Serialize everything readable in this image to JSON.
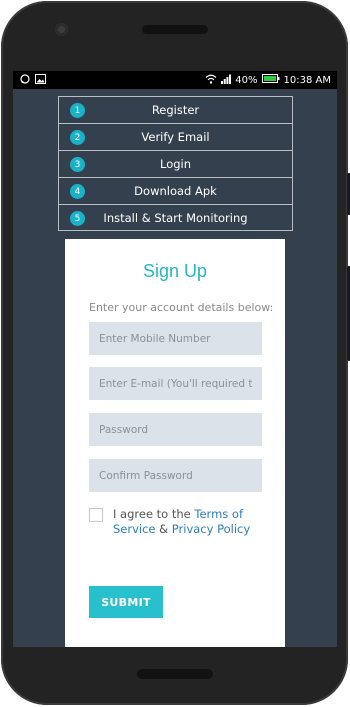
{
  "status_bar": {
    "left_icons": [
      "whatsapp-icon",
      "image-icon"
    ],
    "battery": "40%",
    "time": "10:38 AM"
  },
  "steps": [
    {
      "num": "1",
      "label": "Register"
    },
    {
      "num": "2",
      "label": "Verify Email"
    },
    {
      "num": "3",
      "label": "Login"
    },
    {
      "num": "4",
      "label": "Download Apk"
    },
    {
      "num": "5",
      "label": "Install & Start Monitoring"
    }
  ],
  "form": {
    "title": "Sign Up",
    "subtitle": "Enter your account details below:",
    "mobile_placeholder": "Enter Mobile Number",
    "email_placeholder": "Enter E-mail (You'll required to",
    "password_placeholder": "Password",
    "confirm_placeholder": "Confirm Password",
    "agree_prefix": "I agree to the ",
    "terms_link": "Terms of Service",
    "agree_mid": " & ",
    "privacy_link": "Privacy Policy",
    "submit_label": "SUBMIT"
  },
  "colors": {
    "accent": "#23b6c6",
    "screen_bg": "#34404e",
    "link": "#2c7fb8",
    "field_bg": "#dce2ea"
  }
}
